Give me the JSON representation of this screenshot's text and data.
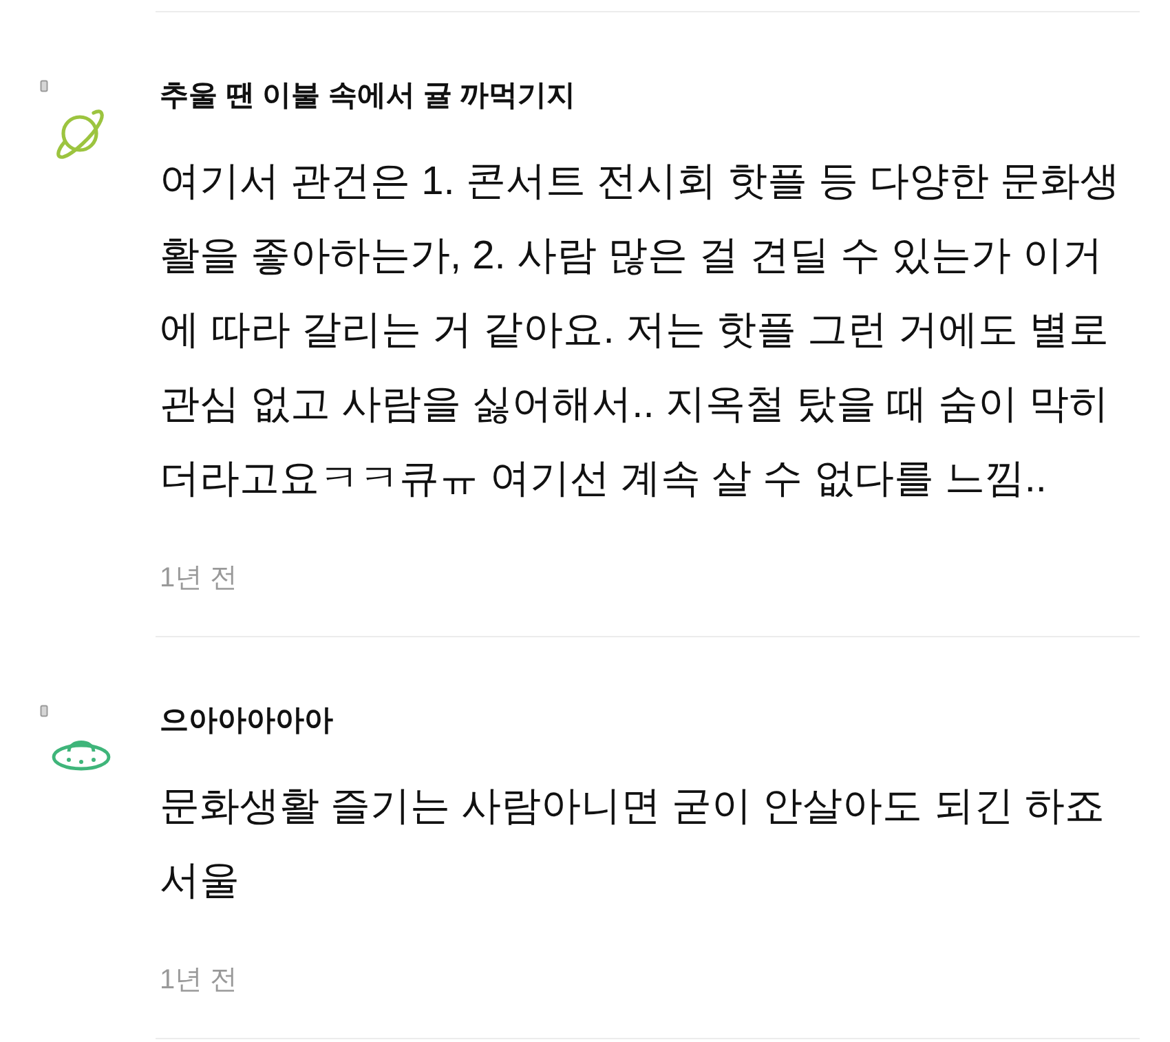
{
  "comments": [
    {
      "avatar": {
        "kind": "planet",
        "color": "#9cc43f"
      },
      "author": "추울 땐 이불 속에서 귤 까먹기지",
      "body": "여기서 관건은 1. 콘서트 전시회 핫플 등 다양한 문화생활을 좋아하는가, 2. 사람 많은 걸 견딜 수 있는가 이거에 따라 갈리는 거 같아요. 저는 핫플 그런 거에도 별로 관심 없고 사람을 싫어해서.. 지옥철 탔을 때 숨이 막히더라고요ㅋㅋ큐ㅠ 여기선 계속 살 수 없다를 느낌..",
      "time": "1년 전"
    },
    {
      "avatar": {
        "kind": "ufo",
        "color": "#3fb57a"
      },
      "author": "으아아아아아",
      "body": "문화생활 즐기는 사람아니면 굳이 안살아도 되긴 하죠 서울",
      "time": "1년 전"
    }
  ]
}
